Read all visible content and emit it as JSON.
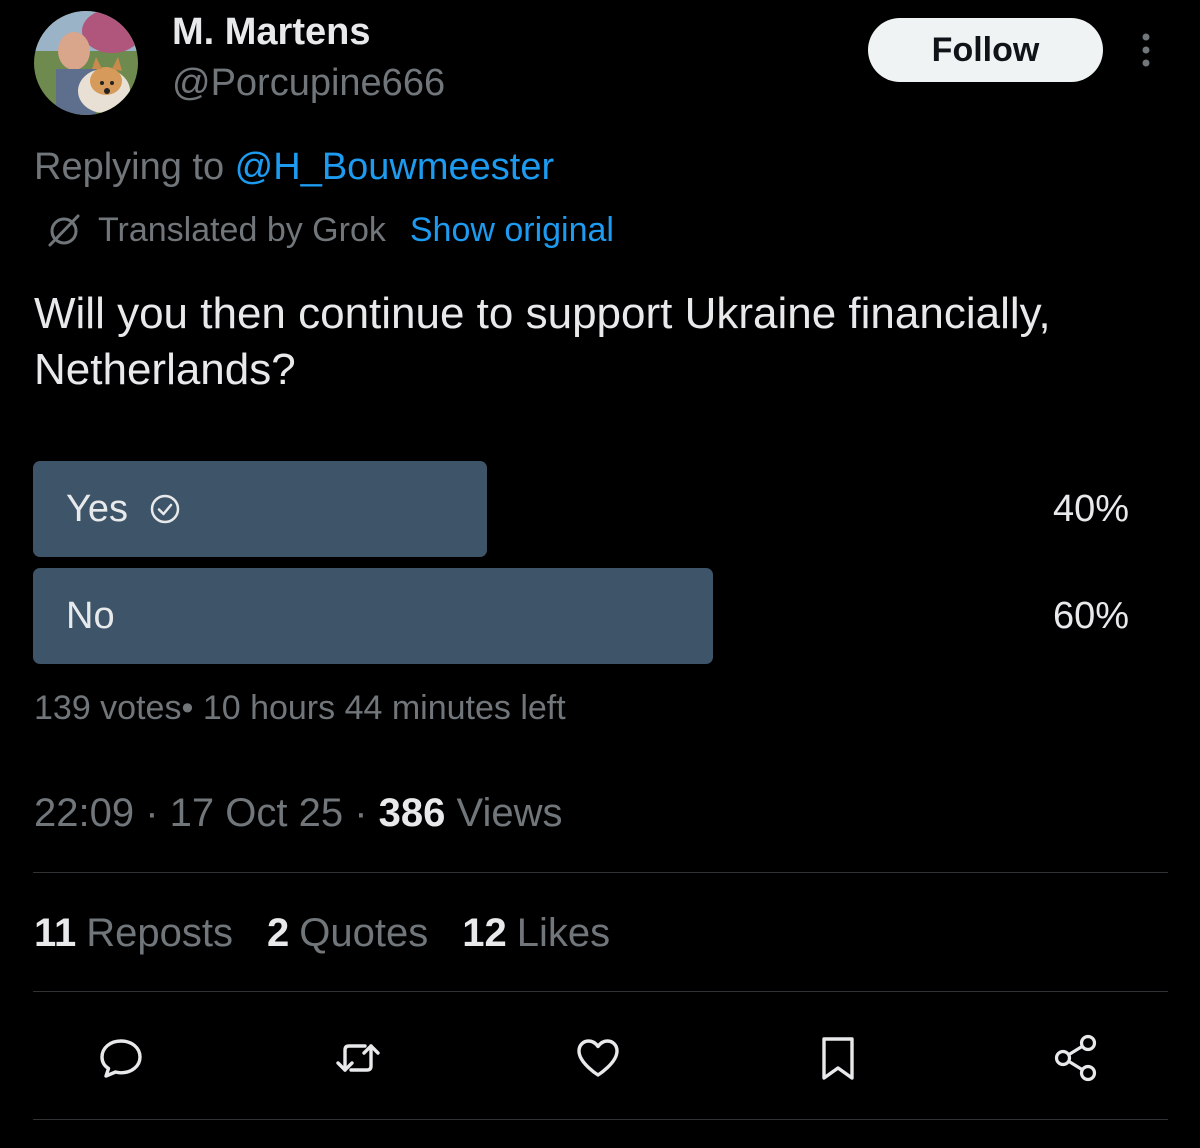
{
  "author": {
    "display_name": "M. Martens",
    "handle": "@Porcupine666"
  },
  "header": {
    "follow_label": "Follow"
  },
  "reply": {
    "prefix": "Replying to ",
    "mention": "@H_Bouwmeester"
  },
  "translation": {
    "label": "Translated by Grok",
    "show_original": "Show original"
  },
  "post": {
    "text": "Will you then continue to support Ukraine financially, Netherlands?"
  },
  "poll": {
    "options": [
      {
        "label": "Yes",
        "percent": "40%",
        "share": 0.4,
        "chosen": true
      },
      {
        "label": "No",
        "percent": "60%",
        "share": 0.6,
        "chosen": false
      }
    ],
    "votes": "139 votes",
    "time_left": "10 hours 44 minutes left"
  },
  "meta": {
    "time": "22:09",
    "date": "17 Oct 25",
    "views_count": "386",
    "views_label": "Views"
  },
  "stats": {
    "reposts_count": "11",
    "reposts_label": "Reposts",
    "quotes_count": "2",
    "quotes_label": "Quotes",
    "likes_count": "12",
    "likes_label": "Likes"
  },
  "icons": {
    "reply": "comment-icon",
    "repost": "repost-icon",
    "like": "heart-icon",
    "bookmark": "bookmark-icon",
    "share": "share-icon"
  },
  "colors": {
    "background": "#000000",
    "text_primary": "#e7e9ea",
    "text_secondary": "#71767b",
    "link": "#1d9bf0",
    "poll_bar": "#3e5469",
    "divider": "#2f3336"
  }
}
